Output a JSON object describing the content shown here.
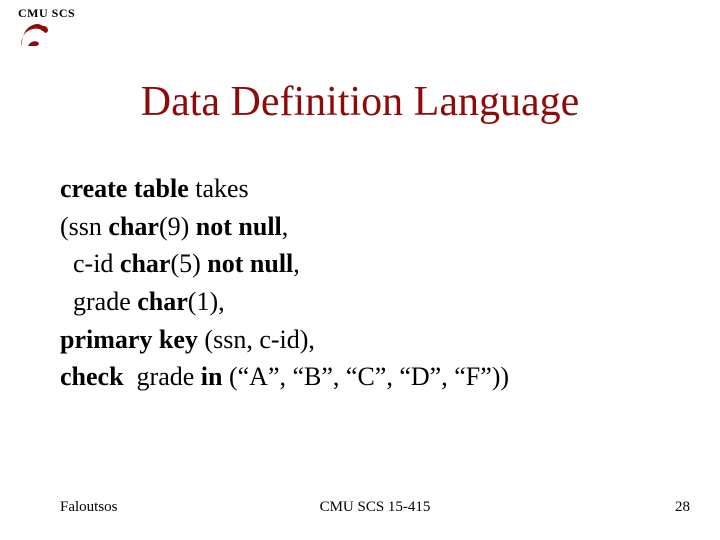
{
  "header": {
    "org": "CMU SCS"
  },
  "title": "Data Definition Language",
  "code": {
    "line1_kw": "create table",
    "line1_rest": " takes",
    "line2_a": "(ssn ",
    "line2_kw1": "char",
    "line2_b": "(9) ",
    "line2_kw2": "not null",
    "line2_c": ",",
    "line3_a": "  c-id ",
    "line3_kw1": "char",
    "line3_b": "(5) ",
    "line3_kw2": "not null",
    "line3_c": ",",
    "line4_a": "  grade ",
    "line4_kw1": "char",
    "line4_b": "(1),",
    "line5_kw": "primary key",
    "line5_rest": " (ssn, c-id),",
    "line6_kw1": "check",
    "line6_a": "  grade ",
    "line6_kw2": "in",
    "line6_b": " (“A”, “B”, “C”, “D”, “F”))"
  },
  "footer": {
    "left": "Faloutsos",
    "center": "CMU SCS 15-415",
    "right": "28"
  }
}
